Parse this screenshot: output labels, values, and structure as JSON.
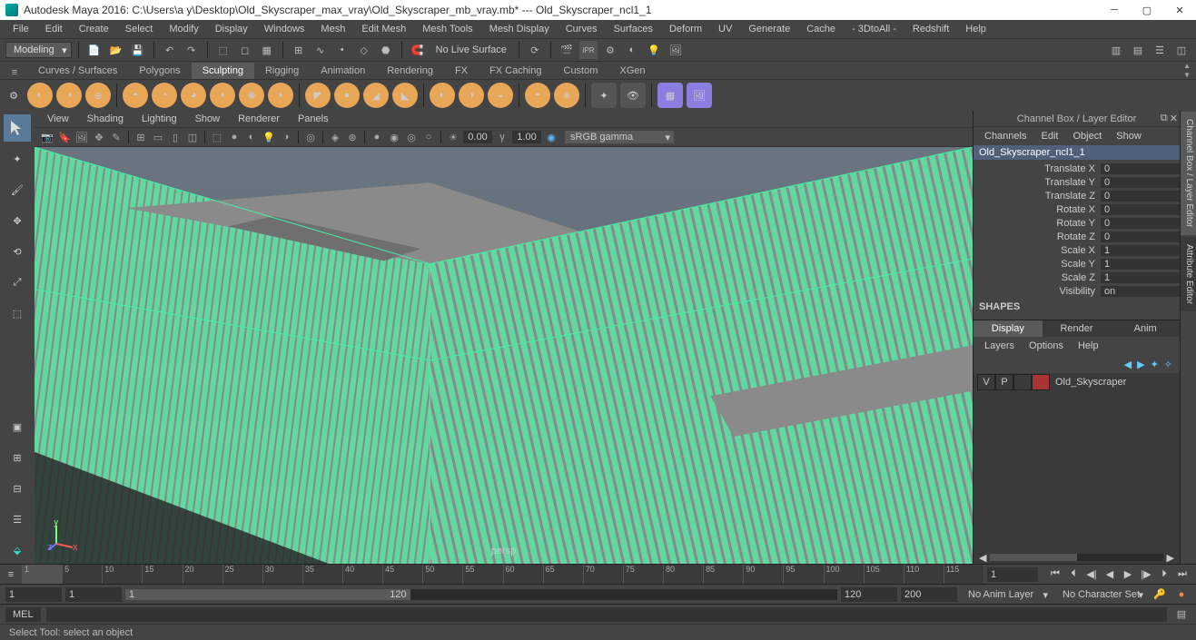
{
  "window": {
    "title": "Autodesk Maya 2016: C:\\Users\\a y\\Desktop\\Old_Skyscraper_max_vray\\Old_Skyscraper_mb_vray.mb*   ---   Old_Skyscraper_ncl1_1"
  },
  "menubar": [
    "File",
    "Edit",
    "Create",
    "Select",
    "Modify",
    "Display",
    "Windows",
    "Mesh",
    "Edit Mesh",
    "Mesh Tools",
    "Mesh Display",
    "Curves",
    "Surfaces",
    "Deform",
    "UV",
    "Generate",
    "Cache",
    "- 3DtoAll -",
    "Redshift",
    "Help"
  ],
  "mode": {
    "current": "Modeling",
    "no_live": "No Live Surface"
  },
  "shelf": {
    "tabs": [
      "Curves / Surfaces",
      "Polygons",
      "Sculpting",
      "Rigging",
      "Animation",
      "Rendering",
      "FX",
      "FX Caching",
      "Custom",
      "XGen"
    ],
    "active": "Sculpting"
  },
  "view_menu": [
    "View",
    "Shading",
    "Lighting",
    "Show",
    "Renderer",
    "Panels"
  ],
  "view_tools": {
    "val1": "0.00",
    "val2": "1.00",
    "colorspace": "sRGB gamma"
  },
  "viewport": {
    "camera": "persp"
  },
  "channelbox": {
    "title": "Channel Box / Layer Editor",
    "menus": [
      "Channels",
      "Edit",
      "Object",
      "Show"
    ],
    "node": "Old_Skyscraper_ncl1_1",
    "attrs": [
      {
        "label": "Translate X",
        "value": "0"
      },
      {
        "label": "Translate Y",
        "value": "0"
      },
      {
        "label": "Translate Z",
        "value": "0"
      },
      {
        "label": "Rotate X",
        "value": "0"
      },
      {
        "label": "Rotate Y",
        "value": "0"
      },
      {
        "label": "Rotate Z",
        "value": "0"
      },
      {
        "label": "Scale X",
        "value": "1"
      },
      {
        "label": "Scale Y",
        "value": "1"
      },
      {
        "label": "Scale Z",
        "value": "1"
      },
      {
        "label": "Visibility",
        "value": "on"
      }
    ],
    "shapes_label": "SHAPES",
    "tabs": [
      "Display",
      "Render",
      "Anim"
    ],
    "active_tab": "Display",
    "layer_menus": [
      "Layers",
      "Options",
      "Help"
    ],
    "layer": {
      "v": "V",
      "p": "P",
      "name": "Old_Skyscraper"
    }
  },
  "right_tabs": [
    "Channel Box / Layer Editor",
    "Attribute Editor"
  ],
  "timeslider": {
    "ticks": [
      "1",
      "5",
      "10",
      "15",
      "20",
      "25",
      "30",
      "35",
      "40",
      "45",
      "50",
      "55",
      "60",
      "65",
      "70",
      "75",
      "80",
      "85",
      "90",
      "95",
      "100",
      "105",
      "110",
      "115",
      "1"
    ],
    "current": "1"
  },
  "rangeslider": {
    "start": "1",
    "in": "1",
    "range_in": "1",
    "range_out": "120",
    "out": "120",
    "end": "200",
    "animlayer": "No Anim Layer",
    "charset": "No Character Set"
  },
  "cmdline": {
    "label": "MEL"
  },
  "helpline": {
    "text": "Select Tool: select an object"
  }
}
